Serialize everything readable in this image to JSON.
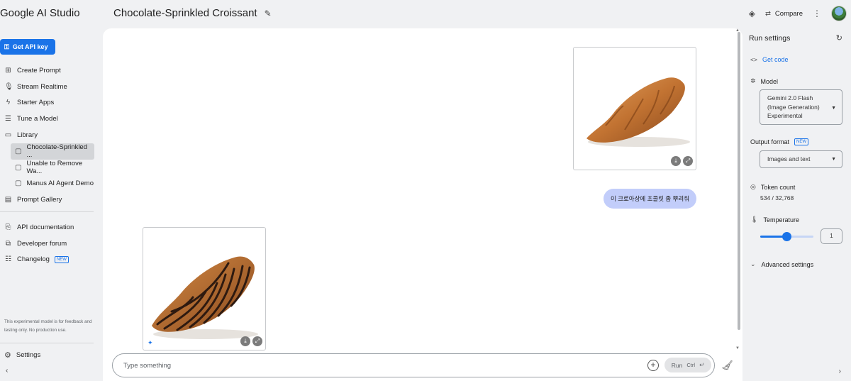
{
  "app": {
    "title": "Google AI Studio"
  },
  "document": {
    "title": "Chocolate-Sprinkled Croissant"
  },
  "header": {
    "compare_label": "Compare"
  },
  "sidebar": {
    "api_key_label": "Get API key",
    "nav": [
      {
        "label": "Create Prompt",
        "icon": "create-prompt-icon"
      },
      {
        "label": "Stream Realtime",
        "icon": "microphone-icon"
      },
      {
        "label": "Starter Apps",
        "icon": "bolt-icon"
      },
      {
        "label": "Tune a Model",
        "icon": "tune-icon"
      },
      {
        "label": "Library",
        "icon": "folder-icon"
      }
    ],
    "library": [
      {
        "label": "Chocolate-Sprinkled ...",
        "active": true
      },
      {
        "label": "Unable to Remove Wa..."
      },
      {
        "label": "Manus AI Agent Demo"
      }
    ],
    "prompt_gallery_label": "Prompt Gallery",
    "secondary": [
      {
        "label": "API documentation"
      },
      {
        "label": "Developer forum"
      },
      {
        "label": "Changelog",
        "badge": "NEW"
      }
    ],
    "disclaimer": "This experimental model is for feedback and testing only. No production use.",
    "settings_label": "Settings"
  },
  "chat": {
    "user_message": "이 크로아상에 초콜릿 좀 뿌려줘",
    "input_placeholder": "Type something",
    "run_label": "Run",
    "run_shortcut": "Ctrl"
  },
  "run_settings": {
    "title": "Run settings",
    "get_code_label": "Get code",
    "model_label": "Model",
    "model_value": "Gemini 2.0 Flash (Image Generation) Experimental",
    "output_format_label": "Output format",
    "output_format_badge": "NEW",
    "output_format_value": "Images and text",
    "token_count_label": "Token count",
    "token_count_value": "534 / 32,768",
    "temperature_label": "Temperature",
    "temperature_value": "1",
    "temperature_fraction": 0.5,
    "advanced_label": "Advanced settings"
  },
  "colors": {
    "accent": "#1a73e8",
    "user_bubble": "#c2cdfa",
    "croissant": "#c97a3a",
    "chocolate": "#3a2418"
  }
}
